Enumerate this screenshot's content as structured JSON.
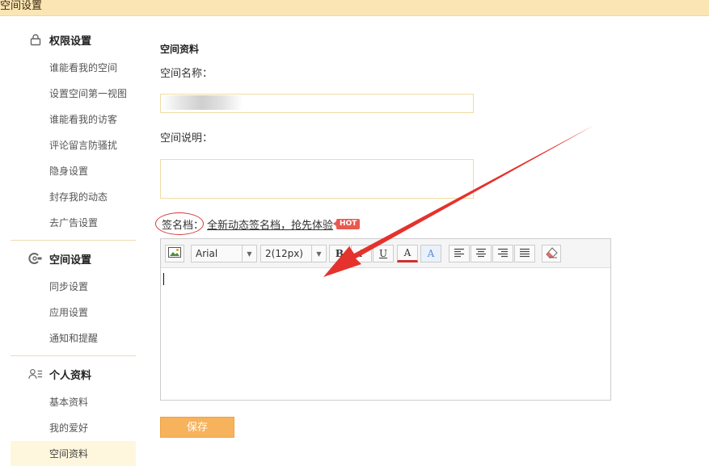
{
  "header": {
    "title": "空间设置"
  },
  "sidebar": {
    "groups": [
      {
        "title": "权限设置",
        "icon": "lock-icon",
        "items": [
          "谁能看我的空间",
          "设置空间第一视图",
          "谁能看我的访客",
          "评论留言防骚扰",
          "隐身设置",
          "封存我的动态",
          "去广告设置"
        ]
      },
      {
        "title": "空间设置",
        "icon": "gear-icon",
        "items": [
          "同步设置",
          "应用设置",
          "通知和提醒"
        ]
      },
      {
        "title": "个人资料",
        "icon": "user-list-icon",
        "items": [
          "基本资料",
          "我的爱好",
          "空间资料"
        ]
      }
    ],
    "active_item": "空间资料"
  },
  "main": {
    "section_title": "空间资料",
    "name_label": "空间名称：",
    "name_value": "",
    "desc_label": "空间说明：",
    "desc_value": "",
    "signature_label": "签名档：",
    "signature_link": "全新动态签名档，抢先体验",
    "hot_badge": "HOT",
    "editor": {
      "font_family": "Arial",
      "font_size": "2(12px)",
      "bold": "B",
      "italic": "I",
      "underline": "U",
      "font_color_glyph": "A",
      "highlight_glyph": "A"
    },
    "save_label": "保存"
  },
  "colors": {
    "header_bg": "#fbe5b4",
    "input_border": "#f2dca0",
    "save_bg": "#f7b25c",
    "active_item_bg": "#fff7dd",
    "annotation_red": "#e5322d",
    "hot_red": "#e85a4f"
  }
}
